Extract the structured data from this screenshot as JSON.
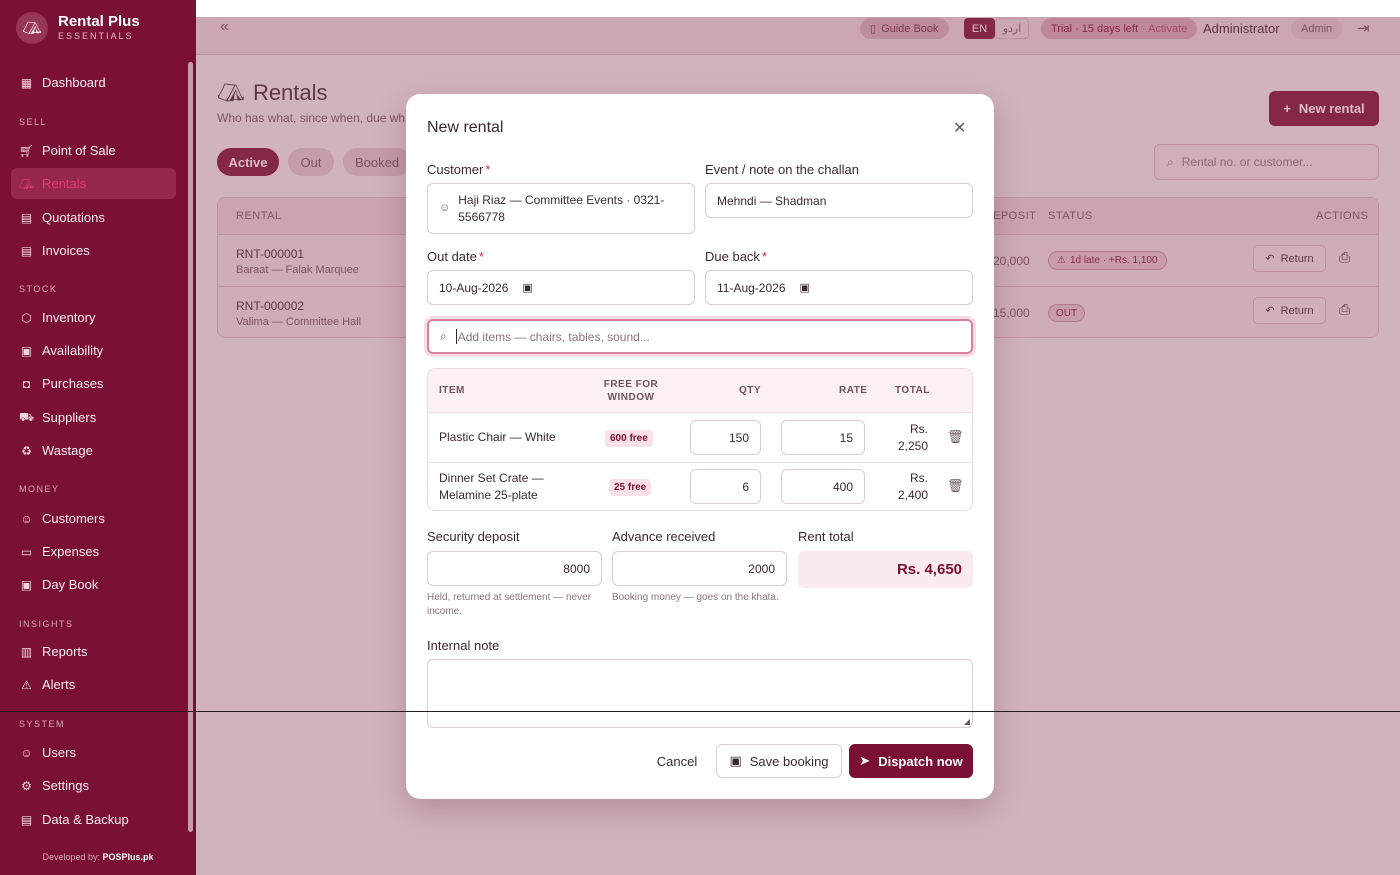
{
  "app": {
    "name": "Rental Plus",
    "edition": "ESSENTIALS",
    "footer_prefix": "Developed by:",
    "footer_brand": "POSPlus.pk"
  },
  "sidebar": {
    "sections": [
      "SELL",
      "STOCK",
      "MONEY",
      "INSIGHTS",
      "SYSTEM"
    ],
    "items": [
      {
        "label": "Dashboard",
        "icon": "dashboard-icon"
      },
      {
        "label": "Point of Sale",
        "icon": "cart-icon"
      },
      {
        "label": "Rentals",
        "icon": "tent-icon",
        "active": true
      },
      {
        "label": "Quotations",
        "icon": "quote-icon"
      },
      {
        "label": "Invoices",
        "icon": "invoice-icon"
      },
      {
        "label": "Inventory",
        "icon": "box-icon"
      },
      {
        "label": "Availability",
        "icon": "calendar-icon"
      },
      {
        "label": "Purchases",
        "icon": "bag-icon"
      },
      {
        "label": "Suppliers",
        "icon": "truck-icon"
      },
      {
        "label": "Wastage",
        "icon": "trash-icon"
      },
      {
        "label": "Customers",
        "icon": "users-icon"
      },
      {
        "label": "Expenses",
        "icon": "wallet-icon"
      },
      {
        "label": "Day Book",
        "icon": "book-icon"
      },
      {
        "label": "Reports",
        "icon": "chart-icon"
      },
      {
        "label": "Alerts",
        "icon": "alert-icon"
      },
      {
        "label": "Users",
        "icon": "user-icon"
      },
      {
        "label": "Settings",
        "icon": "gear-icon"
      },
      {
        "label": "Data & Backup",
        "icon": "database-icon"
      }
    ]
  },
  "topbar": {
    "guide": "Guide Book",
    "lang_en": "EN",
    "lang_ur": "اردو",
    "trial": "Trial · 15 days left",
    "activate": "· Activate",
    "user": "Administrator",
    "role": "Admin"
  },
  "page": {
    "title": "Rentals",
    "subtitle": "Who has what, since when, due wh",
    "new_button": "New rental",
    "tabs": [
      "Active",
      "Out",
      "Booked"
    ],
    "search_placeholder": "Rental no. or customer..."
  },
  "table": {
    "headers": {
      "rental": "RENTAL",
      "deposit": "EPOSIT",
      "status": "STATUS",
      "actions": "ACTIONS"
    },
    "rows": [
      {
        "no": "RNT-000001",
        "sub": "Baraat — Falak Marquee",
        "deposit": "20,000",
        "status": "1d late · +Rs. 1,100",
        "action": "Return"
      },
      {
        "no": "RNT-000002",
        "sub": "Valima — Committee Hall",
        "deposit": "15,000",
        "status": "OUT",
        "action": "Return"
      }
    ]
  },
  "modal": {
    "title": "New rental",
    "customer_label": "Customer",
    "customer_value": "Haji Riaz — Committee Events · 0321-5566778",
    "event_label": "Event / note on the challan",
    "event_value": "Mehndi — Shadman",
    "out_label": "Out date",
    "out_value": "10-Aug-2026",
    "due_label": "Due back",
    "due_value": "11-Aug-2026",
    "item_search_placeholder": "Add items — chairs, tables, sound...",
    "items_header": {
      "item": "ITEM",
      "free": "FREE FOR WINDOW",
      "qty": "QTY",
      "rate": "RATE",
      "total": "TOTAL"
    },
    "items": [
      {
        "name": "Plastic Chair — White",
        "free": "600 free",
        "qty": "150",
        "rate": "15",
        "total": "Rs. 2,250"
      },
      {
        "name": "Dinner Set Crate — Melamine 25-plate",
        "free": "25 free",
        "qty": "6",
        "rate": "400",
        "total": "Rs. 2,400"
      }
    ],
    "deposit_label": "Security deposit",
    "deposit_value": "8000",
    "deposit_hint": "Held, returned at settlement — never income.",
    "advance_label": "Advance received",
    "advance_value": "2000",
    "advance_hint": "Booking money — goes on the khata.",
    "rent_total_label": "Rent total",
    "rent_total_value": "Rs. 4,650",
    "note_label": "Internal note",
    "cancel": "Cancel",
    "save": "Save booking",
    "dispatch": "Dispatch now"
  }
}
